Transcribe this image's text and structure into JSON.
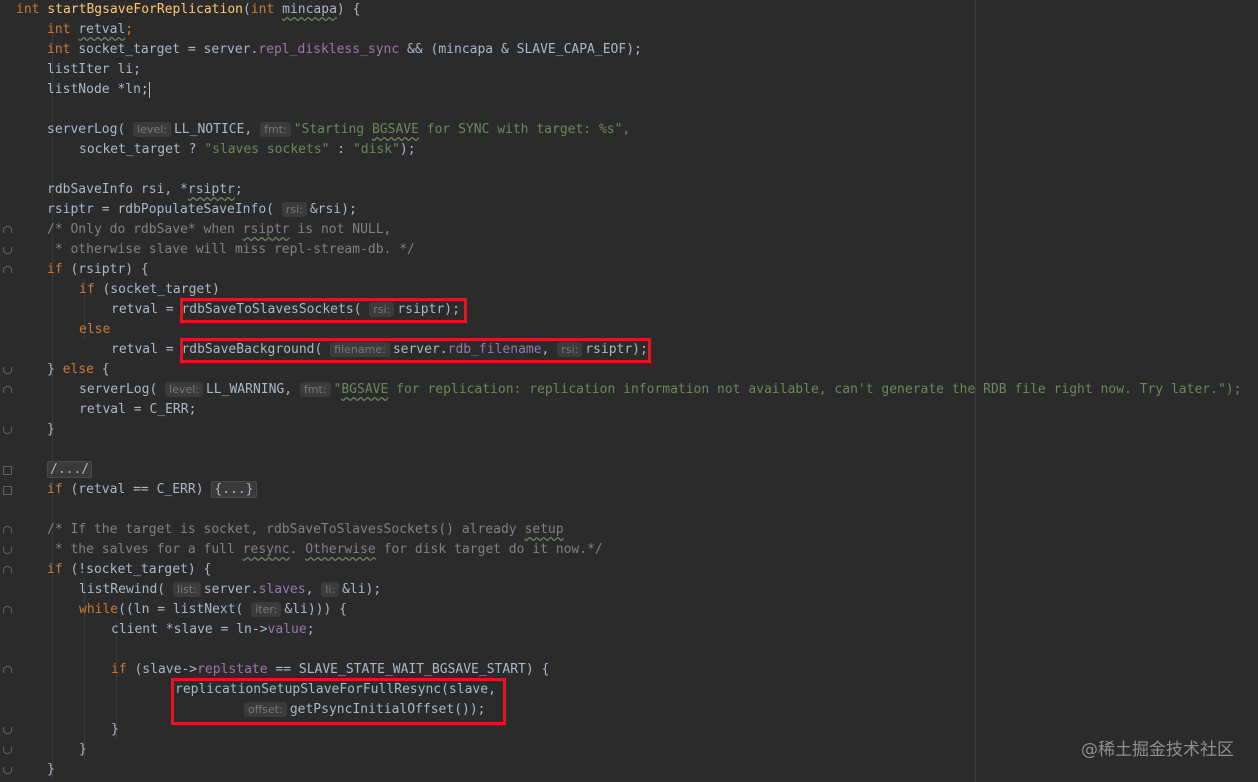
{
  "code": {
    "l1": [
      "int",
      "startBgsaveForReplication",
      "(",
      "int",
      "mincapa",
      ") {"
    ],
    "l2": [
      "int",
      "retval",
      ";"
    ],
    "l3": [
      "int",
      "socket_target = server.",
      "repl_diskless_sync",
      " && (mincapa & SLAVE_CAPA_EOF);"
    ],
    "l4": "listIter li;",
    "l5": "listNode *ln;",
    "l7": [
      "serverLog(",
      "level:",
      "LL_NOTICE, ",
      "fmt:",
      "\"Starting ",
      "BGSAVE",
      " for SYNC with target: %s\","
    ],
    "l8": [
      "socket_target ? ",
      "\"slaves sockets\"",
      " : ",
      "\"disk\"",
      ");"
    ],
    "l10": [
      "rdbSaveInfo rsi, *",
      "rsiptr",
      ";"
    ],
    "l11": [
      "rsiptr = rdbPopulateSaveInfo(",
      "rsi:",
      "&rsi);"
    ],
    "l12": [
      "/* Only do rdbSave* when ",
      "rsiptr",
      " is not NULL,"
    ],
    "l13": " * otherwise slave will miss repl-stream-db. */",
    "l14": [
      "if",
      " (rsiptr) {"
    ],
    "l15": [
      "if",
      " (socket_target)"
    ],
    "l16": [
      "retval = ",
      "rdbSaveToSlavesSockets(",
      "rsi:",
      "rsiptr);"
    ],
    "l17": "else",
    "l18": [
      "retval = ",
      "rdbSaveBackground(",
      "filename:",
      "server.",
      "rdb_filename",
      ", ",
      "rsi:",
      "rsiptr);"
    ],
    "l19": [
      "} ",
      "else",
      " {"
    ],
    "l20": [
      "serverLog(",
      "level:",
      "LL_WARNING, ",
      "fmt:",
      "\"",
      "BGSAVE",
      " for replication: replication information not available, can't generate the RDB file right now. Try later.\");"
    ],
    "l21": "retval = C_ERR;",
    "l22": "}",
    "l24": "/.../",
    "l25": [
      "if",
      " (retval == C_ERR) ",
      "{...}"
    ],
    "l27": [
      "/* If the target is socket, rdbSaveToSlavesSockets() already ",
      "setup"
    ],
    "l28": [
      " * the salves for a full ",
      "resync",
      ". ",
      "Otherwise",
      " for disk target do it now.*/"
    ],
    "l29": [
      "if",
      " (!socket_target) {"
    ],
    "l30": [
      "listRewind(",
      "list:",
      "server.",
      "slaves",
      ", ",
      "li:",
      "&li);"
    ],
    "l31": [
      "while",
      "((ln = listNext(",
      "iter:",
      "&li))) {"
    ],
    "l32": [
      "client *slave = ln->",
      "value",
      ";"
    ],
    "l34": [
      "if",
      " (slave->",
      "replstate",
      " == SLAVE_STATE_WAIT_BGSAVE_START) {"
    ],
    "l35": "replicationSetupSlaveForFullResync(slave,",
    "l36": [
      "offset:",
      "getPsyncInitialOffset());"
    ],
    "l37": "}",
    "l38": "}",
    "l39": "}"
  },
  "watermark": "@稀土掘金技术社区",
  "colors": {
    "background": "#2b2b2b",
    "keyword": "#cc7832",
    "function": "#ffc66d",
    "field": "#9876aa",
    "string": "#6a8759",
    "comment": "#808080",
    "highlight_box": "#e8131f"
  }
}
